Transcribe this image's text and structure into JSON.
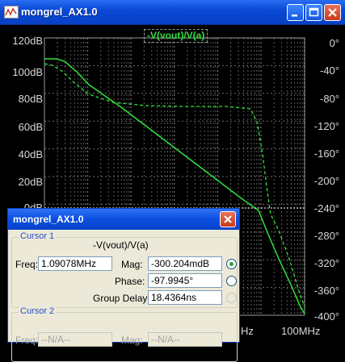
{
  "window": {
    "title": "mongrel_AX1.0"
  },
  "plot": {
    "trace_title": "-V(vout)/V(a)",
    "left_axis_labels": [
      "120dB",
      "100dB",
      "80dB",
      "60dB",
      "40dB",
      "20dB",
      "0dB"
    ],
    "right_axis_labels": [
      "0°",
      "-40°",
      "-80°",
      "-120°",
      "-160°",
      "-200°",
      "-240°",
      "-280°",
      "-320°",
      "-360°",
      "-400°"
    ],
    "x_axis_labels": [
      "Hz",
      "100MHz"
    ],
    "trace_color": "#32e03c"
  },
  "dialog": {
    "title": "mongrel_AX1.0",
    "cursor1": {
      "label": "Cursor 1",
      "trace": "-V(vout)/V(a)",
      "freq_label": "Freq:",
      "freq": "1.09078MHz",
      "mag_label": "Mag:",
      "mag": "-300.204mdB",
      "phase_label": "Phase:",
      "phase": "-97.9945°",
      "gd_label": "Group Delay:",
      "gd": "18.4364ns"
    },
    "cursor2": {
      "label": "Cursor 2",
      "freq_label": "Freq:",
      "freq": "--N/A--",
      "mag_label": "Mag:",
      "mag": "--N/A--"
    }
  }
}
